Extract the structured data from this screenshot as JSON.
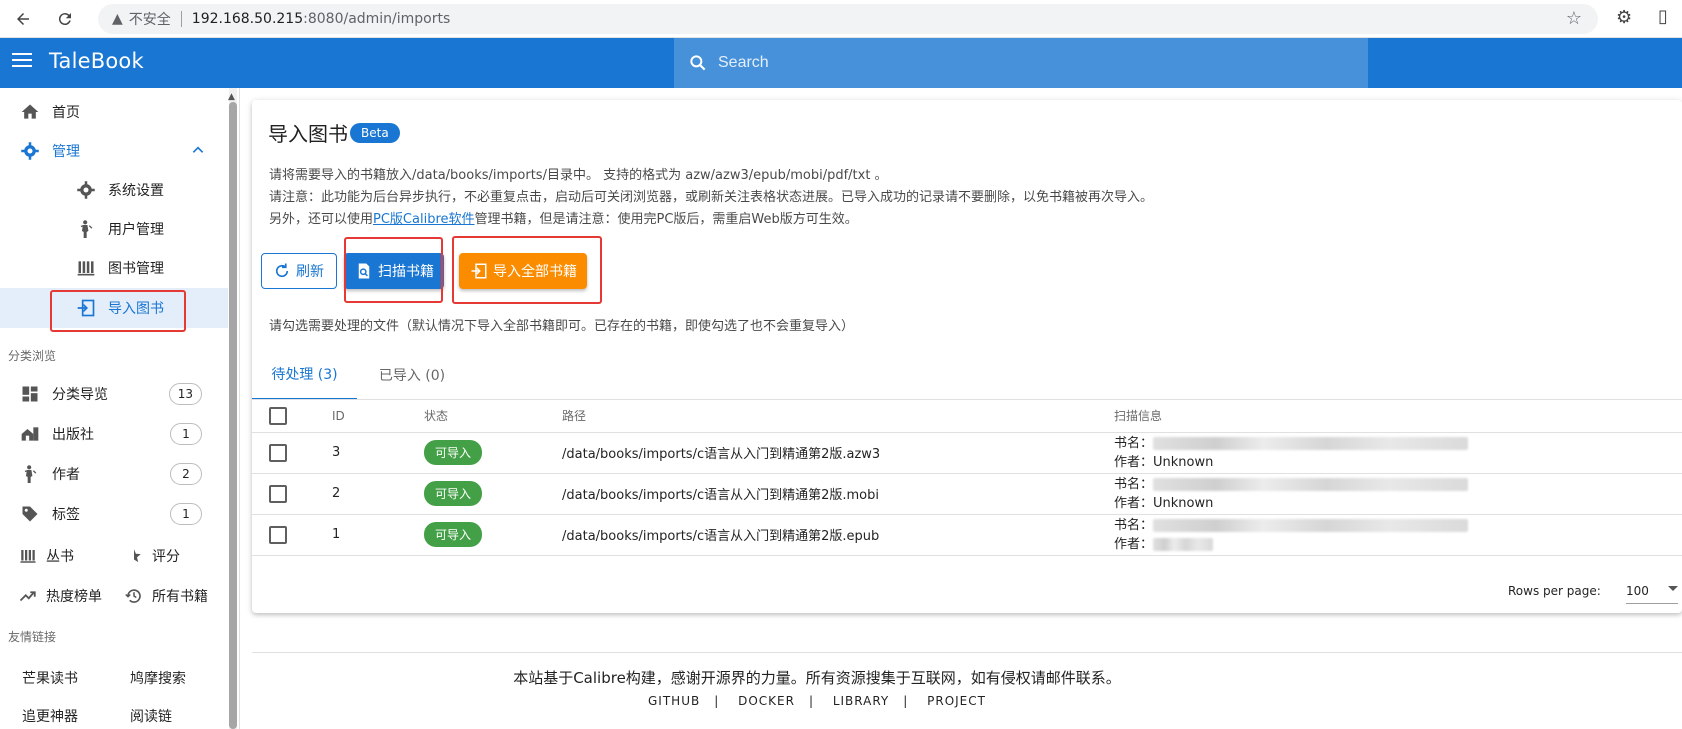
{
  "browser": {
    "insecure_label": "不安全",
    "url_host": "192.168.50.215",
    "url_path": ":8080/admin/imports"
  },
  "app": {
    "title": "TaleBook",
    "search_placeholder": "Search",
    "brand_color": "#1976d2"
  },
  "sidebar": {
    "home": "首页",
    "manage": "管理",
    "manage_children": [
      "系统设置",
      "用户管理",
      "图书管理",
      "导入图书"
    ],
    "browse_header": "分类浏览",
    "browse": [
      {
        "label": "分类导览",
        "count": "13"
      },
      {
        "label": "出版社",
        "count": "1"
      },
      {
        "label": "作者",
        "count": "2"
      },
      {
        "label": "标签",
        "count": "1"
      }
    ],
    "series": "丛书",
    "rating": "评分",
    "hot": "热度榜单",
    "all_books": "所有书籍",
    "links_header": "友情链接",
    "links": [
      "芒果读书",
      "鸠摩搜索",
      "追更神器",
      "阅读链"
    ]
  },
  "page": {
    "title": "导入图书",
    "beta": "Beta",
    "desc1": "请将需要导入的书籍放入/data/books/imports/目录中。 支持的格式为 azw/azw3/epub/mobi/pdf/txt 。",
    "desc2": "请注意：此功能为后台异步执行，不必重复点击，启动后可关闭浏览器，或刷新关注表格状态进展。已导入成功的记录请不要删除，以免书籍被再次导入。",
    "desc3_pre": "另外，还可以使用",
    "desc3_link": "PC版Calibre软件",
    "desc3_post": "管理书籍，但是请注意：使用完PC版后，需重启Web版方可生效。",
    "refresh": "刷新",
    "scan": "扫描书籍",
    "import_all": "导入全部书籍",
    "hint": "请勾选需要处理的文件（默认情况下导入全部书籍即可。已存在的书籍，即使勾选了也不会重复导入）",
    "tab_pending": "待处理 (3)",
    "tab_done": "已导入 (0)",
    "headers": [
      "ID",
      "状态",
      "路径",
      "扫描信息"
    ],
    "rows": [
      {
        "id": "3",
        "status": "可导入",
        "path": "/data/books/imports/c语言从入门到精通第2版.azw3",
        "title_label": "书名：",
        "author_label": "作者：",
        "author": "Unknown"
      },
      {
        "id": "2",
        "status": "可导入",
        "path": "/data/books/imports/c语言从入门到精通第2版.mobi",
        "title_label": "书名：",
        "author_label": "作者：",
        "author": "Unknown"
      },
      {
        "id": "1",
        "status": "可导入",
        "path": "/data/books/imports/c语言从入门到精通第2版.epub",
        "title_label": "书名：",
        "author_label": "作者：",
        "author": ""
      }
    ],
    "rows_per_page_label": "Rows per page:",
    "rows_per_page": "100"
  },
  "footer": {
    "text": "本站基于Calibre构建，感谢开源界的力量。所有资源搜集于互联网，如有侵权请邮件联系。",
    "links": [
      "GITHUB",
      "DOCKER",
      "LIBRARY",
      "PROJECT"
    ]
  }
}
